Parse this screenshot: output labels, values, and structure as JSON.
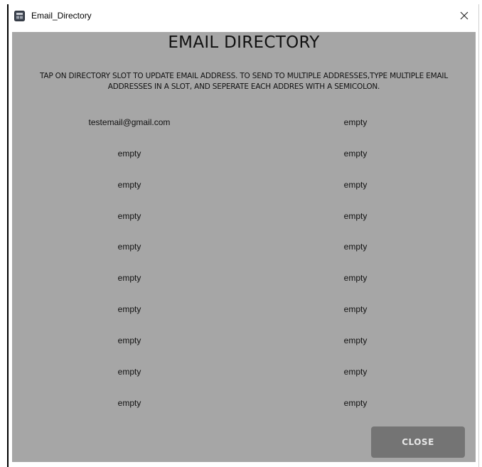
{
  "window": {
    "title": "Email_Directory",
    "icon": "email-directory-app-icon",
    "close_glyph": "✕"
  },
  "header": {
    "title": "EMAIL DIRECTORY",
    "instructions": "TAP ON DIRECTORY SLOT TO UPDATE EMAIL ADDRESS. TO SEND TO MULTIPLE ADDRESSES,TYPE MULTIPLE EMAIL\nADDRESSES IN A SLOT, AND SEPERATE EACH ADDRES WITH A SEMICOLON."
  },
  "slots": [
    "testemail@gmail.com",
    "empty",
    "empty",
    "empty",
    "empty",
    "empty",
    "empty",
    "empty",
    "empty",
    "empty",
    "empty",
    "empty",
    "empty",
    "empty",
    "empty",
    "empty",
    "empty",
    "empty",
    "empty",
    "empty"
  ],
  "footer": {
    "close_label": "CLOSE"
  },
  "colors": {
    "panel_bg": "#a6a6a6",
    "button_bg": "#747474",
    "button_text": "#e8e8e8"
  }
}
